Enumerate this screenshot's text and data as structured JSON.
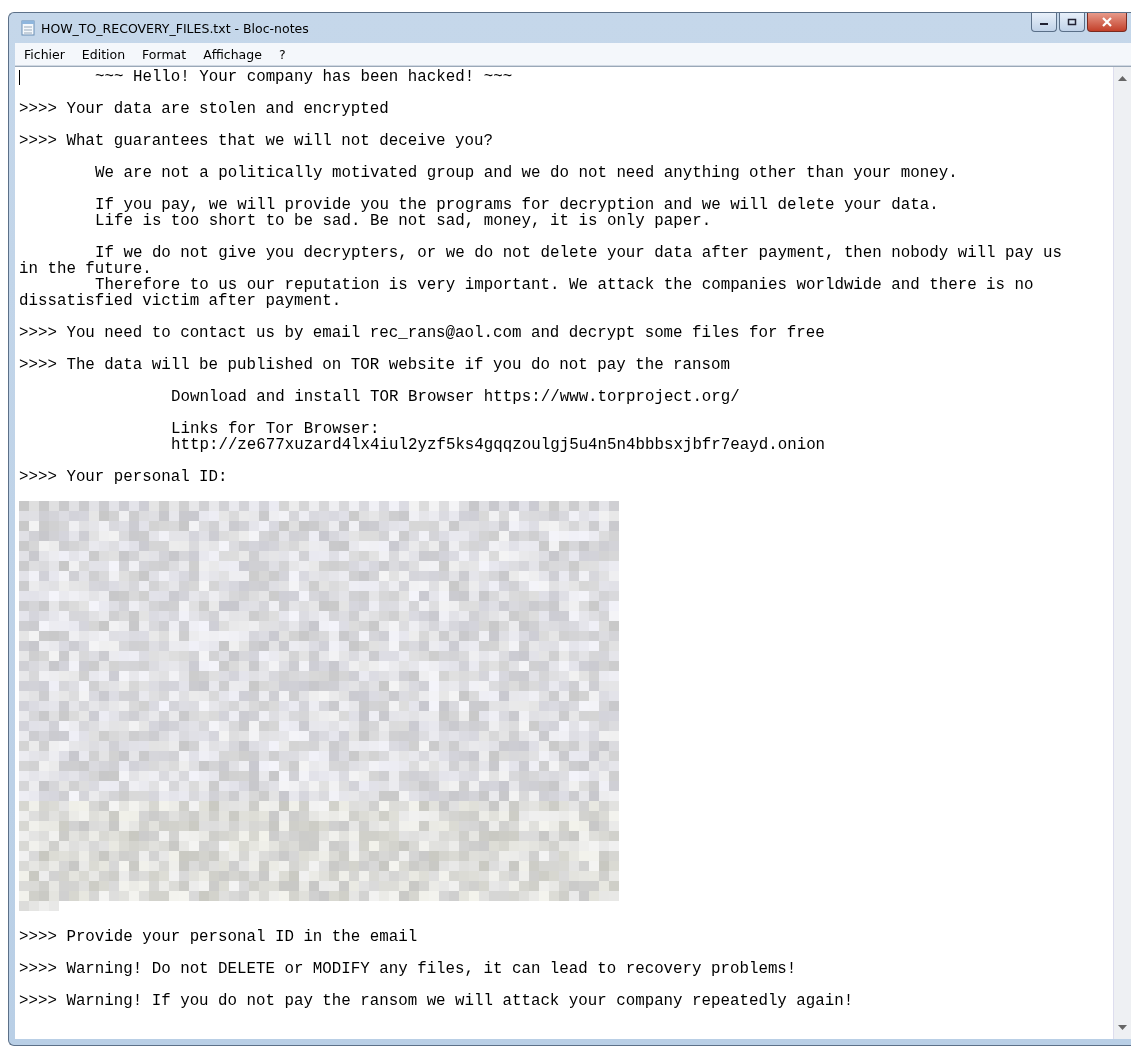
{
  "window": {
    "title": "HOW_TO_RECOVERY_FILES.txt - Bloc-notes"
  },
  "menu": [
    "Fichier",
    "Edition",
    "Format",
    "Affichage",
    "?"
  ],
  "lines": [
    {
      "kind": "indent1",
      "text": "~~~ Hello! Your company has been hacked! ~~~",
      "cursor": true
    },
    {
      "kind": "blank"
    },
    {
      "kind": "plain",
      "text": ">>>> Your data are stolen and encrypted"
    },
    {
      "kind": "blank"
    },
    {
      "kind": "plain",
      "text": ">>>> What guarantees that we will not deceive you?"
    },
    {
      "kind": "blank"
    },
    {
      "kind": "indent1",
      "text": "We are not a politically motivated group and we do not need anything other than your money."
    },
    {
      "kind": "blank"
    },
    {
      "kind": "indent1",
      "text": "If you pay, we will provide you the programs for decryption and we will delete your data."
    },
    {
      "kind": "indent1",
      "text": "Life is too short to be sad. Be not sad, money, it is only paper."
    },
    {
      "kind": "blank"
    },
    {
      "kind": "indent1",
      "text": "If we do not give you decrypters, or we do not delete your data after payment, then nobody will pay us"
    },
    {
      "kind": "plain",
      "text": "in the future."
    },
    {
      "kind": "indent1",
      "text": "Therefore to us our reputation is very important. We attack the companies worldwide and there is no"
    },
    {
      "kind": "plain",
      "text": "dissatisfied victim after payment."
    },
    {
      "kind": "blank"
    },
    {
      "kind": "plain",
      "text": ">>>> You need to contact us by email rec_rans@aol.com and decrypt some files for free"
    },
    {
      "kind": "blank"
    },
    {
      "kind": "plain",
      "text": ">>>> The data will be published on TOR website if you do not pay the ransom"
    },
    {
      "kind": "blank"
    },
    {
      "kind": "indent2",
      "text": "Download and install TOR Browser https://www.torproject.org/"
    },
    {
      "kind": "blank"
    },
    {
      "kind": "indent2",
      "text": "Links for Tor Browser:"
    },
    {
      "kind": "indent2",
      "text": "http://ze677xuzard4lx4iul2yzf5ks4gqqzoulgj5u4n5n4bbbsxjbfr7eayd.onion"
    },
    {
      "kind": "blank"
    },
    {
      "kind": "plain",
      "text": ">>>> Your personal ID:"
    },
    {
      "kind": "blank"
    },
    {
      "kind": "redacted"
    },
    {
      "kind": "blank"
    },
    {
      "kind": "plain",
      "text": ">>>> Provide your personal ID in the email"
    },
    {
      "kind": "blank"
    },
    {
      "kind": "plain",
      "text": ">>>> Warning! Do not DELETE or MODIFY any files, it can lead to recovery problems!"
    },
    {
      "kind": "blank"
    },
    {
      "kind": "plain",
      "text": ">>>> Warning! If you do not pay the ransom we will attack your company repeatedly again!"
    }
  ]
}
